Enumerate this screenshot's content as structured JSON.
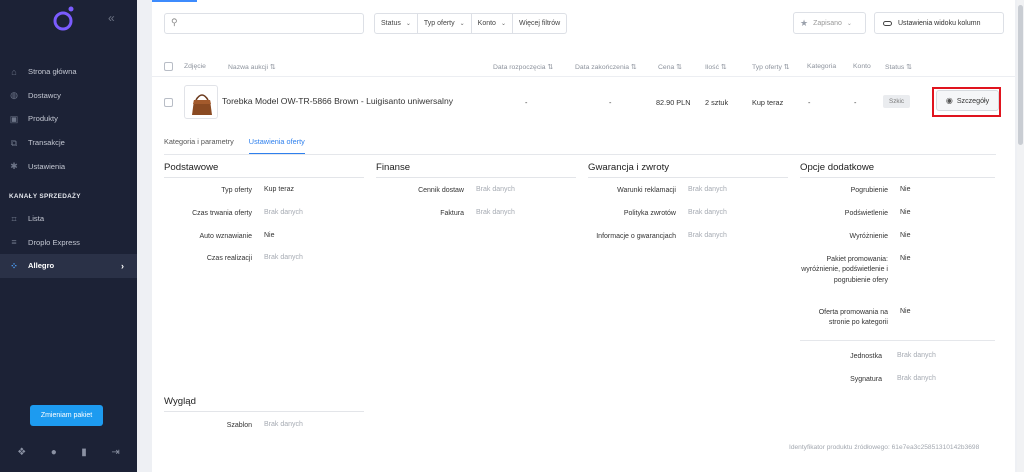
{
  "sidebar": {
    "collapse_icon": "«",
    "nav": [
      {
        "label": "Strona główna",
        "icon": "home-icon"
      },
      {
        "label": "Dostawcy",
        "icon": "suppliers-icon"
      },
      {
        "label": "Produkty",
        "icon": "box-icon"
      },
      {
        "label": "Transakcje",
        "icon": "transactions-icon"
      },
      {
        "label": "Ustawienia",
        "icon": "gear-icon"
      }
    ],
    "section_title": "KANAŁY SPRZEDAŻY",
    "channels": [
      {
        "label": "Lista",
        "icon": "list-icon"
      },
      {
        "label": "Droplo Express",
        "icon": "express-icon"
      },
      {
        "label": "Allegro",
        "icon": "allegro-icon",
        "active": true
      }
    ],
    "package_button": "Zmieniam pakiet"
  },
  "toolbar": {
    "search_placeholder": "",
    "filters": [
      "Status",
      "Typ oferty",
      "Konto",
      "Więcej filtrów"
    ],
    "saved_label": "Zapisano",
    "view_settings_label": "Ustawienia widoku kolumn"
  },
  "table": {
    "headers": {
      "photo": "Zdjęcie",
      "name": "Nazwa aukcji",
      "start": "Data rozpoczęcia",
      "end": "Data zakończenia",
      "price": "Cena",
      "qty": "Ilość",
      "type": "Typ oferty",
      "category": "Kategoria",
      "account": "Konto",
      "status": "Status"
    },
    "row": {
      "name": "Torebka Model OW-TR-5866 Brown - Luigisanto uniwersalny",
      "start": "-",
      "end": "-",
      "price": "82.90 PLN",
      "qty": "2 sztuk",
      "type": "Kup teraz",
      "category": "-",
      "account": "-",
      "status": "Szkic",
      "details_button": "Szczegóły"
    }
  },
  "tabs": [
    {
      "label": "Kategoria i parametry",
      "active": false
    },
    {
      "label": "Ustawienia oferty",
      "active": true
    }
  ],
  "sections": {
    "basic": {
      "title": "Podstawowe",
      "rows": [
        {
          "k": "Typ oferty",
          "v": "Kup teraz",
          "empty": false
        },
        {
          "k": "Czas trwania oferty",
          "v": "Brak danych",
          "empty": true
        },
        {
          "k": "Auto wznawianie",
          "v": "Nie",
          "empty": false
        },
        {
          "k": "Czas realizacji",
          "v": "Brak danych",
          "empty": true
        }
      ]
    },
    "finance": {
      "title": "Finanse",
      "rows": [
        {
          "k": "Cennik dostaw",
          "v": "Brak danych",
          "empty": true
        },
        {
          "k": "Faktura",
          "v": "Brak danych",
          "empty": true
        }
      ]
    },
    "warranty": {
      "title": "Gwarancja i zwroty",
      "rows": [
        {
          "k": "Warunki reklamacji",
          "v": "Brak danych",
          "empty": true
        },
        {
          "k": "Polityka zwrotów",
          "v": "Brak danych",
          "empty": true
        },
        {
          "k": "Informacje o gwarancjach",
          "v": "Brak danych",
          "empty": true
        }
      ]
    },
    "extra": {
      "title": "Opcje dodatkowe",
      "rows": [
        {
          "k": "Pogrubienie",
          "v": "Nie",
          "empty": false
        },
        {
          "k": "Podświetlenie",
          "v": "Nie",
          "empty": false
        },
        {
          "k": "Wyróżnienie",
          "v": "Nie",
          "empty": false
        },
        {
          "k": "Pakiet promowania: wyróżnienie, podświetlenie i pogrubienie ofery",
          "v": "Nie",
          "empty": false
        },
        {
          "k": "Oferta promowania na stronie po kategorii",
          "v": "Nie",
          "empty": false
        },
        {
          "k": "Jednostka",
          "v": "Brak danych",
          "empty": true
        },
        {
          "k": "Sygnatura",
          "v": "Brak danych",
          "empty": true
        }
      ]
    },
    "look": {
      "title": "Wygląd",
      "rows": [
        {
          "k": "Szablon",
          "v": "Brak danych",
          "empty": true
        }
      ]
    }
  },
  "footer_id": "Identyfikator produktu źródłowego: 61e7ea3c25851310142b3698",
  "colors": {
    "sidebar_bg": "#1c2236",
    "accent": "#2f80ed",
    "button_blue": "#1d9bf0",
    "highlight_red": "#e0141e"
  }
}
